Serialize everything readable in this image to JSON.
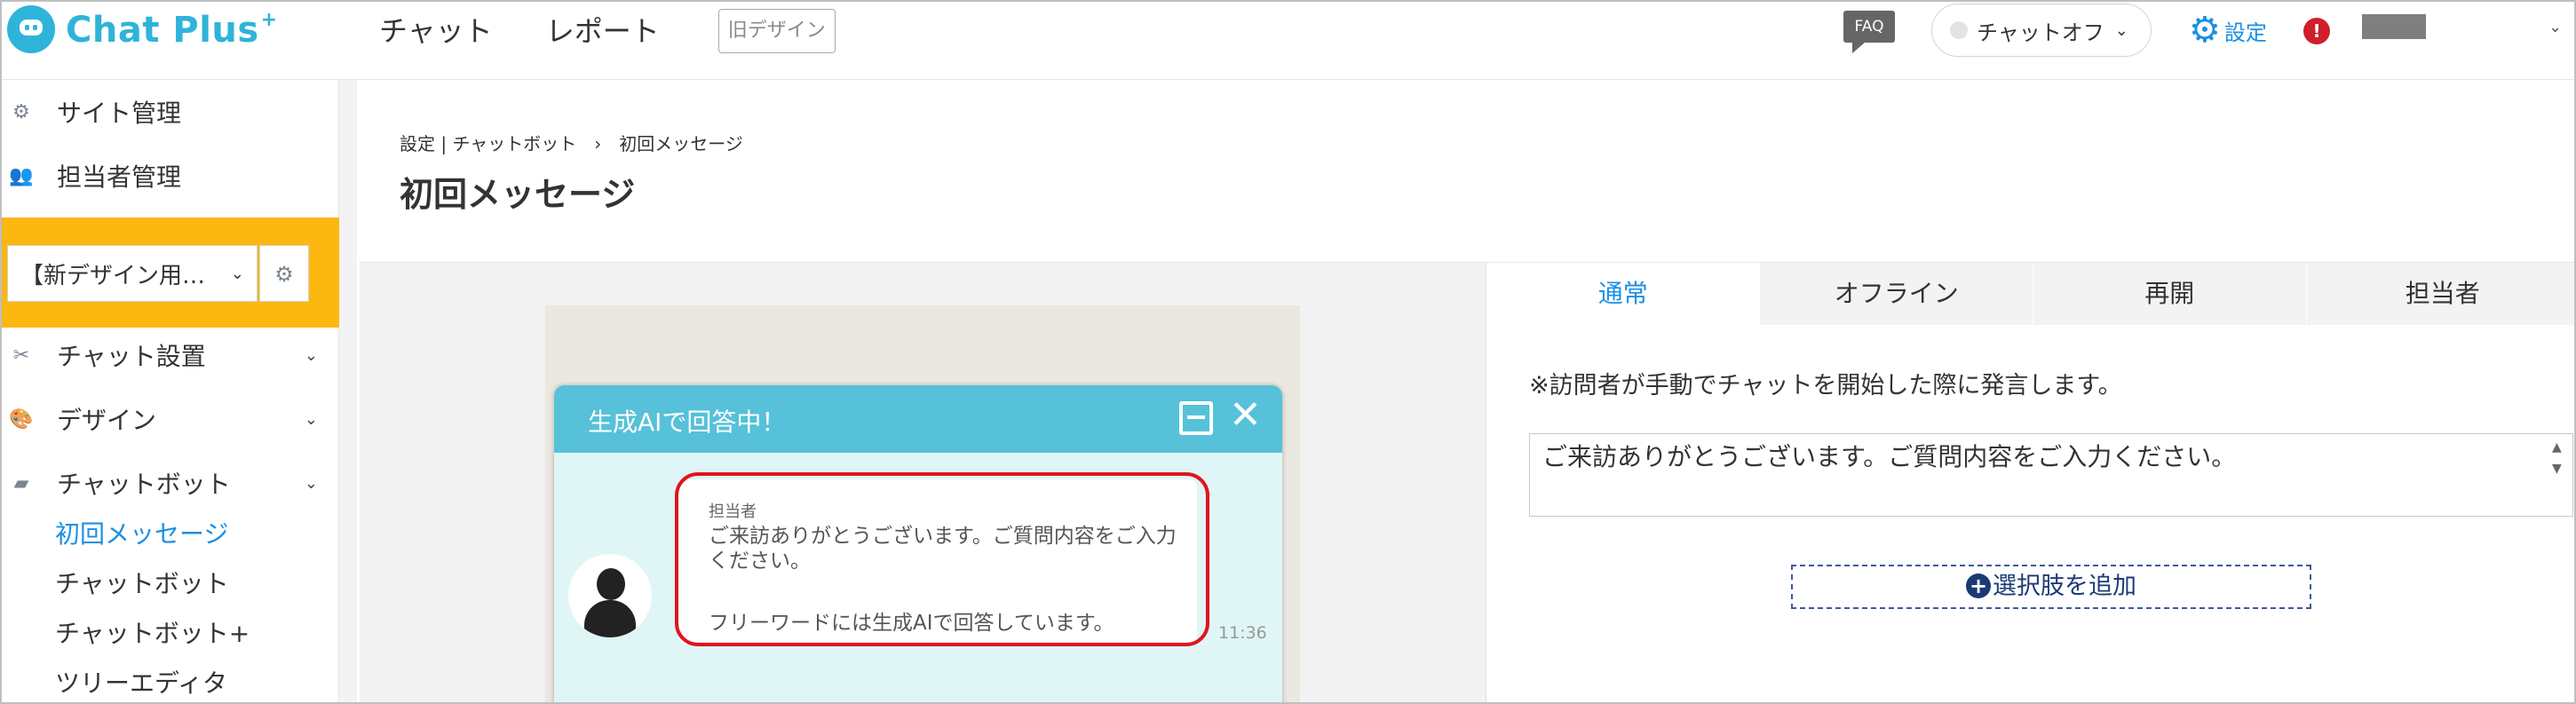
{
  "header": {
    "logo_text": "Chat Plus",
    "logo_sup": "+",
    "nav": [
      "チャット",
      "レポート"
    ],
    "old_design": "旧デザイン",
    "faq": "FAQ",
    "chat_status": "チャットオフ",
    "settings": "設定",
    "alert": "!"
  },
  "sidebar": {
    "site_admin": "サイト管理",
    "staff_admin": "担当者管理",
    "site_select": "【新デザイン用…",
    "chat_setup": "チャット設置",
    "design": "デザイン",
    "chatbot": "チャットボット",
    "sub_items": [
      "初回メッセージ",
      "チャットボット",
      "チャットボット+",
      "ツリーエディタ"
    ]
  },
  "main": {
    "breadcrumb": "設定 | チャットボット　›　初回メッセージ",
    "title": "初回メッセージ"
  },
  "widget": {
    "title": "生成AIで回答中！",
    "sender": "担当者",
    "message_line1": "ご来訪ありがとうございます。ご質問内容をご入力ください。",
    "message_line2": "フリーワードには生成AIで回答しています。",
    "time": "11:36"
  },
  "right_panel": {
    "tabs": [
      "通常",
      "オフライン",
      "再開",
      "担当者"
    ],
    "note": "※訪問者が手動でチャットを開始した際に発言します。",
    "textarea_value": "ご来訪ありがとうございます。ご質問内容をご入力ください。",
    "add_choice": "選択肢を追加"
  },
  "colors": {
    "brand": "#2fb4d9",
    "link_blue": "#1a8fe3",
    "sidebar_highlight": "#fcb711",
    "widget_header": "#56c1d9",
    "highlight_red": "#e0141d"
  }
}
